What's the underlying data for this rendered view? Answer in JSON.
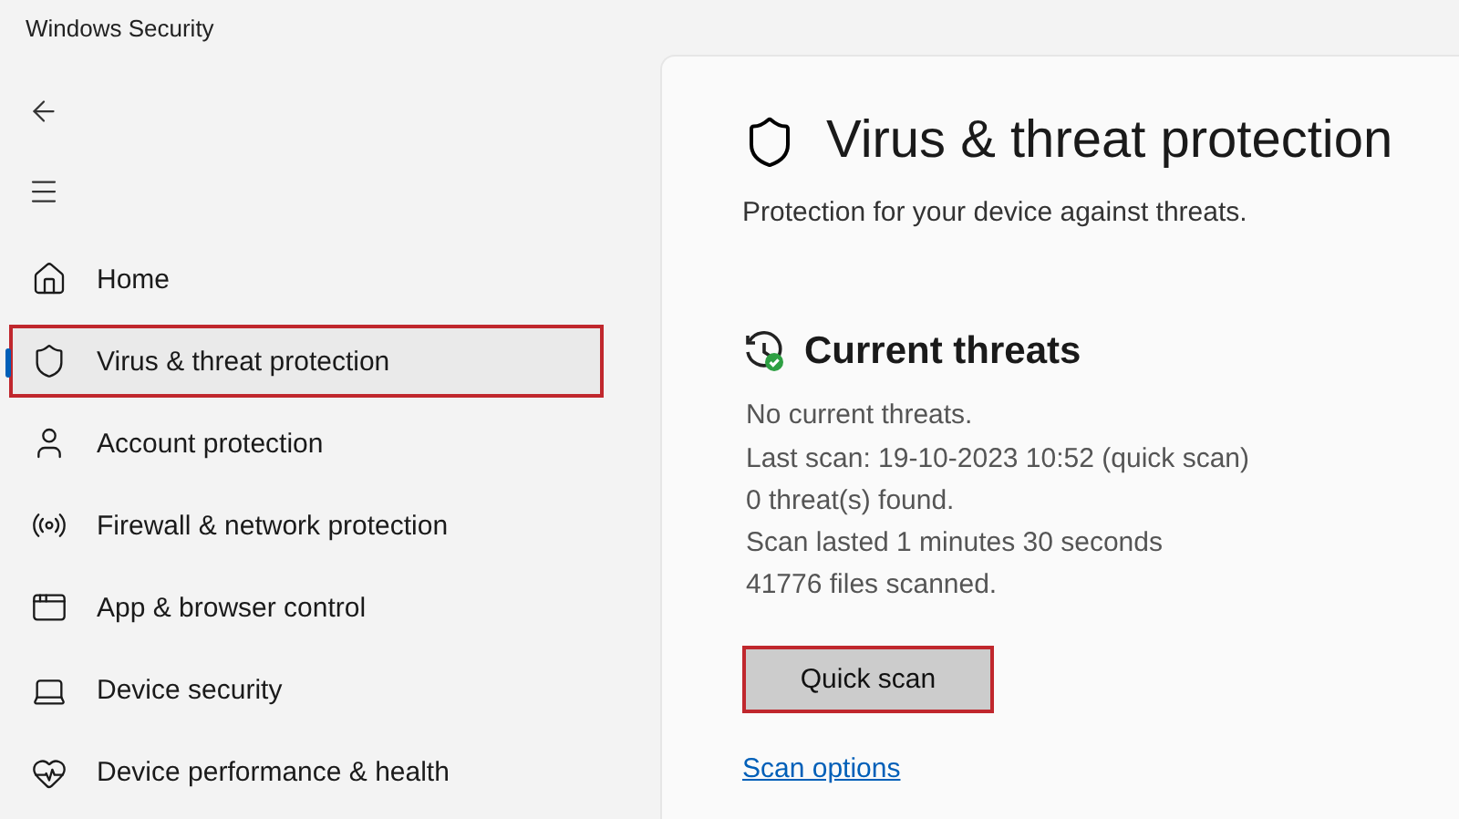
{
  "window": {
    "title": "Windows Security"
  },
  "sidebar": {
    "items": [
      {
        "kind": "home",
        "label": "Home",
        "selected": false,
        "highlighted": false
      },
      {
        "kind": "shield",
        "label": "Virus & threat protection",
        "selected": true,
        "highlighted": true
      },
      {
        "kind": "account",
        "label": "Account protection",
        "selected": false,
        "highlighted": false
      },
      {
        "kind": "firewall",
        "label": "Firewall & network protection",
        "selected": false,
        "highlighted": false
      },
      {
        "kind": "app",
        "label": "App & browser control",
        "selected": false,
        "highlighted": false
      },
      {
        "kind": "device",
        "label": "Device security",
        "selected": false,
        "highlighted": false
      },
      {
        "kind": "health",
        "label": "Device performance & health",
        "selected": false,
        "highlighted": false
      }
    ]
  },
  "page": {
    "title": "Virus & threat protection",
    "subtitle": "Protection for your device against threats.",
    "section": {
      "title": "Current threats",
      "status": "No current threats.",
      "details": [
        "Last scan: 19-10-2023 10:52 (quick scan)",
        "0 threat(s) found.",
        "Scan lasted 1 minutes 30 seconds",
        "41776 files scanned."
      ],
      "button": {
        "label": "Quick scan",
        "highlighted": true
      },
      "link": "Scan options"
    }
  }
}
